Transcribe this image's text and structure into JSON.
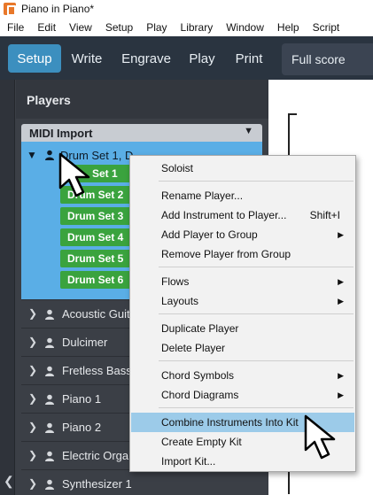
{
  "window": {
    "title": "Piano in Piano*"
  },
  "menubar": [
    "File",
    "Edit",
    "View",
    "Setup",
    "Play",
    "Library",
    "Window",
    "Help",
    "Script"
  ],
  "modes": [
    {
      "label": "Setup",
      "active": true
    },
    {
      "label": "Write",
      "active": false
    },
    {
      "label": "Engrave",
      "active": false
    },
    {
      "label": "Play",
      "active": false
    },
    {
      "label": "Print",
      "active": false
    }
  ],
  "layout_selector": {
    "value": "Full score"
  },
  "players_panel": {
    "title": "Players",
    "group": {
      "label": "MIDI Import"
    },
    "selected_player": {
      "label": "Drum Set 1, D",
      "kit_items": [
        "Set 1",
        "Drum Set 2",
        "Drum Set 3",
        "Drum Set 4",
        "Drum Set 5",
        "Drum Set 6"
      ]
    },
    "players": [
      "Acoustic Guit",
      "Dulcimer",
      "Fretless Bass",
      "Piano 1",
      "Piano 2",
      "Electric Organ",
      "Synthesizer 1"
    ]
  },
  "context_menu": {
    "items": [
      {
        "label": "Soloist"
      },
      {
        "label": "Rename Player..."
      },
      {
        "label": "Add Instrument to Player...",
        "shortcut": "Shift+I"
      },
      {
        "label": "Add Player to Group",
        "submenu": true
      },
      {
        "label": "Remove Player from Group"
      },
      {
        "label": "Flows",
        "submenu": true
      },
      {
        "label": "Layouts",
        "submenu": true
      },
      {
        "label": "Duplicate Player"
      },
      {
        "label": "Delete Player"
      },
      {
        "label": "Chord Symbols",
        "submenu": true
      },
      {
        "label": "Chord Diagrams",
        "submenu": true
      },
      {
        "label": "Combine Instruments Into Kit",
        "highlighted": true
      },
      {
        "label": "Create Empty Kit"
      },
      {
        "label": "Import Kit..."
      }
    ]
  },
  "colors": {
    "toolbar_bg": "#2a3440",
    "active_mode": "#3c8fbf",
    "selected_player_bg": "#5aaee6",
    "kit_green": "#3aa33e",
    "menu_highlight": "#9ccbe9"
  }
}
